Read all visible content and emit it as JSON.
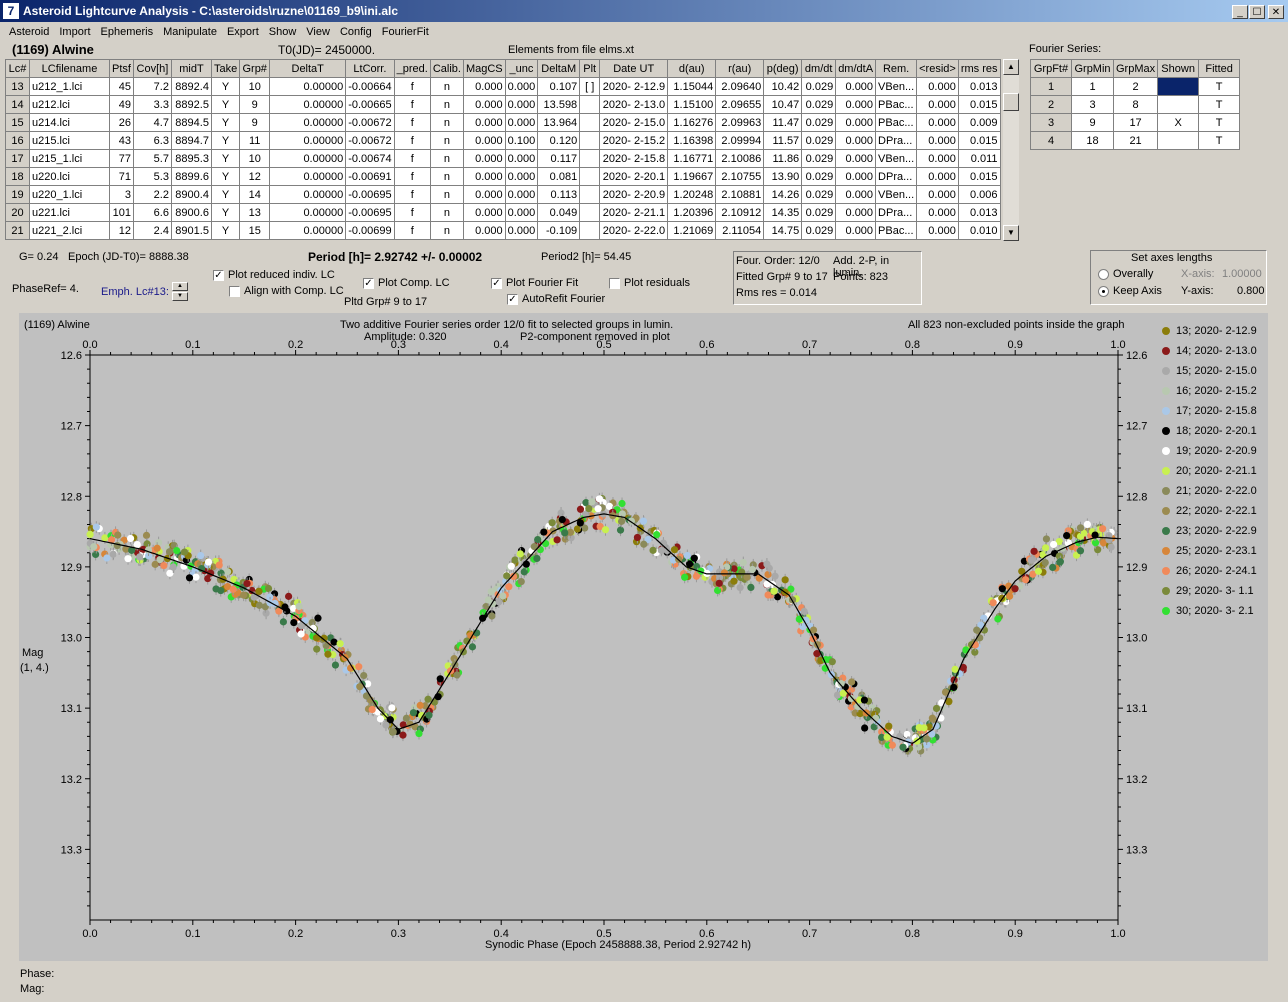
{
  "window": {
    "title": "Asteroid Lightcurve Analysis - C:\\asteroids\\ruzne\\01169_b9\\ini.alc",
    "app_icon": "7",
    "min_glyph": "_",
    "max_glyph": "☐",
    "close_glyph": "✕"
  },
  "menu": [
    "Asteroid",
    "Import",
    "Ephemeris",
    "Manipulate",
    "Export",
    "Show",
    "View",
    "Config",
    "FourierFit"
  ],
  "header": {
    "asteroid": "(1169) Alwine",
    "t0": "T0(JD)= 2450000.",
    "elements": "Elements from file elms.xt"
  },
  "lc_table": {
    "columns": [
      "Lc#",
      "LCfilename",
      "Ptsf",
      "Cov[h]",
      "midT",
      "Take",
      "Grp#",
      "DeltaT",
      "LtCorr.",
      "_pred.",
      "Calib.",
      "MagCS",
      "_unc",
      "DeltaM",
      "Plt",
      "Date UT",
      "d(au)",
      "r(au)",
      "p(deg)",
      "dm/dt",
      "dm/dtA",
      "Rem.",
      "<resid>",
      "rms res"
    ],
    "rows": [
      [
        "13",
        "u212_1.lci",
        "45",
        "7.2",
        "8892.4",
        "Y",
        "10",
        "0.00000",
        "-0.00664",
        "f",
        "n",
        "0.000",
        "0.000",
        "0.107",
        "[ ]",
        "2020- 2-12.9",
        "1.15044",
        "2.09640",
        "10.42",
        "0.029",
        "0.000",
        "VBen...",
        "0.000",
        "0.013"
      ],
      [
        "14",
        "u212.lci",
        "49",
        "3.3",
        "8892.5",
        "Y",
        "9",
        "0.00000",
        "-0.00665",
        "f",
        "n",
        "0.000",
        "0.000",
        "13.598",
        "",
        "2020- 2-13.0",
        "1.15100",
        "2.09655",
        "10.47",
        "0.029",
        "0.000",
        "PBac...",
        "0.000",
        "0.015"
      ],
      [
        "15",
        "u214.lci",
        "26",
        "4.7",
        "8894.5",
        "Y",
        "9",
        "0.00000",
        "-0.00672",
        "f",
        "n",
        "0.000",
        "0.000",
        "13.964",
        "",
        "2020- 2-15.0",
        "1.16276",
        "2.09963",
        "11.47",
        "0.029",
        "0.000",
        "PBac...",
        "0.000",
        "0.009"
      ],
      [
        "16",
        "u215.lci",
        "43",
        "6.3",
        "8894.7",
        "Y",
        "11",
        "0.00000",
        "-0.00672",
        "f",
        "n",
        "0.000",
        "0.100",
        "0.120",
        "",
        "2020- 2-15.2",
        "1.16398",
        "2.09994",
        "11.57",
        "0.029",
        "0.000",
        "DPra...",
        "0.000",
        "0.015"
      ],
      [
        "17",
        "u215_1.lci",
        "77",
        "5.7",
        "8895.3",
        "Y",
        "10",
        "0.00000",
        "-0.00674",
        "f",
        "n",
        "0.000",
        "0.000",
        "0.117",
        "",
        "2020- 2-15.8",
        "1.16771",
        "2.10086",
        "11.86",
        "0.029",
        "0.000",
        "VBen...",
        "0.000",
        "0.011"
      ],
      [
        "18",
        "u220.lci",
        "71",
        "5.3",
        "8899.6",
        "Y",
        "12",
        "0.00000",
        "-0.00691",
        "f",
        "n",
        "0.000",
        "0.000",
        "0.081",
        "",
        "2020- 2-20.1",
        "1.19667",
        "2.10755",
        "13.90",
        "0.029",
        "0.000",
        "DPra...",
        "0.000",
        "0.015"
      ],
      [
        "19",
        "u220_1.lci",
        "3",
        "2.2",
        "8900.4",
        "Y",
        "14",
        "0.00000",
        "-0.00695",
        "f",
        "n",
        "0.000",
        "0.000",
        "0.113",
        "",
        "2020- 2-20.9",
        "1.20248",
        "2.10881",
        "14.26",
        "0.029",
        "0.000",
        "VBen...",
        "0.000",
        "0.006"
      ],
      [
        "20",
        "u221.lci",
        "101",
        "6.6",
        "8900.6",
        "Y",
        "13",
        "0.00000",
        "-0.00695",
        "f",
        "n",
        "0.000",
        "0.000",
        "0.049",
        "",
        "2020- 2-21.1",
        "1.20396",
        "2.10912",
        "14.35",
        "0.029",
        "0.000",
        "DPra...",
        "0.000",
        "0.013"
      ],
      [
        "21",
        "u221_2.lci",
        "12",
        "2.4",
        "8901.5",
        "Y",
        "15",
        "0.00000",
        "-0.00699",
        "f",
        "n",
        "0.000",
        "0.000",
        "-0.109",
        "",
        "2020- 2-22.0",
        "1.21069",
        "2.11054",
        "14.75",
        "0.029",
        "0.000",
        "PBac...",
        "0.000",
        "0.010"
      ]
    ]
  },
  "fourier_series": {
    "label": "Fourier Series:",
    "columns": [
      "GrpFt#",
      "GrpMin",
      "GrpMax",
      "Shown",
      "Fitted"
    ],
    "rows": [
      [
        "1",
        "1",
        "2",
        "",
        "T"
      ],
      [
        "2",
        "3",
        "8",
        "",
        "T"
      ],
      [
        "3",
        "9",
        "17",
        "X",
        "T"
      ],
      [
        "4",
        "18",
        "21",
        "",
        "T"
      ]
    ]
  },
  "info": {
    "g": "G= 0.24",
    "epoch": "Epoch (JD-T0)= 8888.38",
    "period": "Period [h]= 2.92742 +/- 0.00002",
    "period2": "Period2 [h]= 54.45",
    "phaseref": "PhaseRef= 4.",
    "emph": "Emph. Lc#13:"
  },
  "options": {
    "plot_reduced": "Plot reduced indiv. LC",
    "align_comp": "Align with Comp. LC",
    "plot_comp": "Plot Comp. LC",
    "pltd_grp": "Pltd Grp#  9  to  17",
    "plot_fourier": "Plot Fourier Fit",
    "autorefit": "AutoRefit Fourier",
    "plot_residuals": "Plot residuals"
  },
  "fit_box": {
    "order": "Four. Order: 12/0",
    "add": "Add. 2-P, in lumin.",
    "fitted": "Fitted Grp# 9 to 17",
    "points": "Points: 823",
    "rms": "Rms res     = 0.014"
  },
  "axes_box": {
    "title": "Set axes lengths",
    "overally": "Overally",
    "keep": "Keep Axis",
    "xaxis_label": "X-axis:",
    "xaxis_val": "1.00000",
    "yaxis_label": "Y-axis:",
    "yaxis_val": "0.800"
  },
  "plot": {
    "top_left": "(1169) Alwine",
    "title1": "Two additive Fourier series order 12/0 fit to selected groups in lumin.",
    "title2": "Amplitude: 0.320",
    "title3": "P2-component removed in plot",
    "top_right": "All 823 non-excluded points inside the graph",
    "xlabel": "Synodic Phase (Epoch 2458888.38, Period 2.92742 h)",
    "ylabel1": "Mag",
    "ylabel2": "(1, 4.)",
    "phase_label": "Phase:",
    "mag_label": "Mag:"
  },
  "chart_data": {
    "type": "scatter",
    "xlim": [
      0.0,
      1.0
    ],
    "ylim": [
      12.6,
      13.4
    ],
    "y_inverted": true,
    "grid": false,
    "legend_position": "right",
    "x_ticks": [
      "0.0",
      "0.1",
      "0.2",
      "0.3",
      "0.4",
      "0.5",
      "0.6",
      "0.7",
      "0.8",
      "0.9",
      "1.0"
    ],
    "y_ticks": [
      "12.6",
      "12.7",
      "12.8",
      "12.9",
      "13.0",
      "13.1",
      "13.2",
      "13.3"
    ],
    "fit_curve": {
      "x": [
        0.0,
        0.05,
        0.1,
        0.15,
        0.2,
        0.25,
        0.28,
        0.3,
        0.32,
        0.35,
        0.4,
        0.45,
        0.48,
        0.5,
        0.52,
        0.55,
        0.58,
        0.6,
        0.62,
        0.65,
        0.68,
        0.7,
        0.72,
        0.75,
        0.78,
        0.8,
        0.82,
        0.85,
        0.88,
        0.9,
        0.93,
        0.96,
        0.98,
        1.0
      ],
      "y": [
        12.86,
        12.875,
        12.9,
        12.93,
        12.97,
        13.03,
        13.1,
        13.13,
        13.12,
        13.05,
        12.93,
        12.85,
        12.83,
        12.825,
        12.83,
        12.86,
        12.9,
        12.91,
        12.91,
        12.91,
        12.94,
        12.99,
        13.05,
        13.1,
        13.14,
        13.15,
        13.13,
        13.03,
        12.96,
        12.92,
        12.885,
        12.865,
        12.858,
        12.86
      ]
    },
    "series": [
      {
        "name": "13; 2020- 2-12.9",
        "color": "#8b7d0a"
      },
      {
        "name": "14; 2020- 2-13.0",
        "color": "#8b1a1a"
      },
      {
        "name": "15; 2020- 2-15.0",
        "color": "#a9a9a9"
      },
      {
        "name": "16; 2020- 2-15.2",
        "color": "#b8c8b0"
      },
      {
        "name": "17; 2020- 2-15.8",
        "color": "#aac8e8"
      },
      {
        "name": "18; 2020- 2-20.1",
        "color": "#000000"
      },
      {
        "name": "19; 2020- 2-20.9",
        "color": "#ffffff"
      },
      {
        "name": "20; 2020- 2-21.1",
        "color": "#c8f050"
      },
      {
        "name": "21; 2020- 2-22.0",
        "color": "#8a8a5a"
      },
      {
        "name": "22; 2020- 2-22.1",
        "color": "#9b8b50"
      },
      {
        "name": "23; 2020- 2-22.9",
        "color": "#3a7a4a"
      },
      {
        "name": "25; 2020- 2-23.1",
        "color": "#d7863a"
      },
      {
        "name": "26; 2020- 2-24.1",
        "color": "#f08a5a"
      },
      {
        "name": "29; 2020- 3- 1.1",
        "color": "#7a8a3a"
      },
      {
        "name": "30; 2020- 3- 2.1",
        "color": "#32e032"
      }
    ]
  },
  "colors": {
    "selection": "#0a246a",
    "plot_bg": "#c0c0c0",
    "emph_text": "#1a1a8a"
  }
}
